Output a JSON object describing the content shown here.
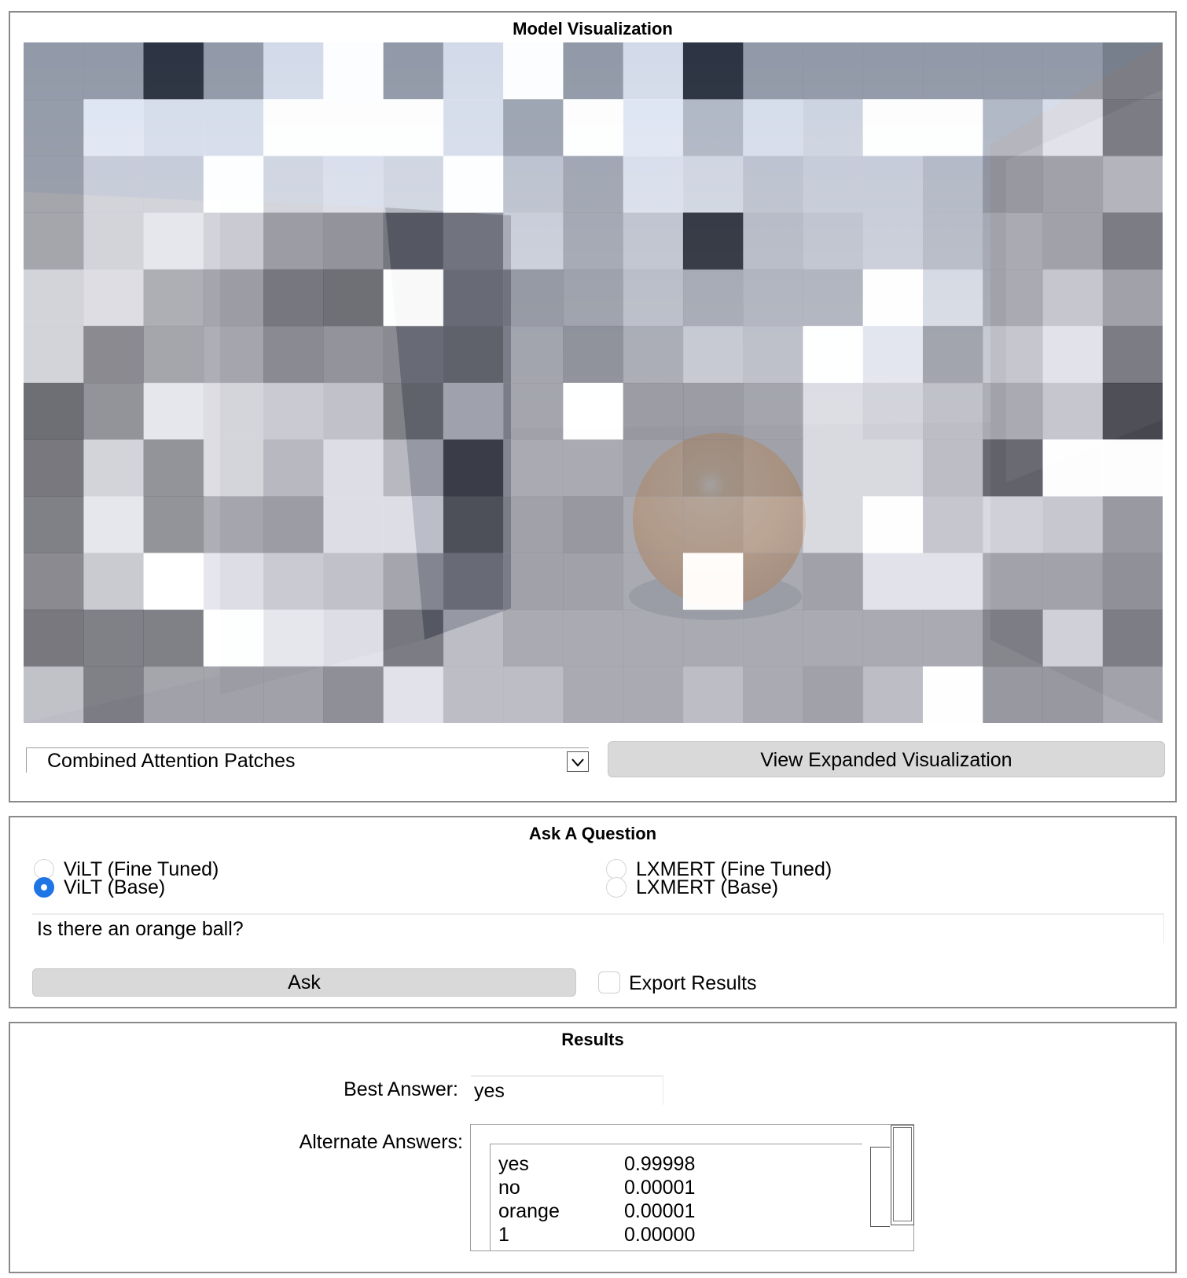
{
  "visualization": {
    "title": "Model Visualization",
    "mode_selected": "Combined Attention Patches",
    "expand_button": "View Expanded Visualization",
    "image": {
      "ball_color": "#f5a755",
      "sky_color": "#b8cfe6",
      "grid_cols": 19,
      "grid_rows": 12,
      "attention_mask": [
        [
          0.55,
          0.55,
          0.0,
          0.55,
          0.9,
          1.0,
          0.55,
          0.9,
          1.0,
          0.55,
          0.9,
          0.0,
          0.55,
          0.55,
          0.55,
          0.55,
          0.55,
          0.55,
          0.4
        ],
        [
          0.55,
          0.95,
          0.9,
          0.9,
          1.0,
          1.0,
          1.0,
          0.9,
          0.6,
          1.0,
          0.95,
          0.7,
          0.9,
          0.85,
          1.0,
          1.0,
          0.7,
          0.9,
          0.35
        ],
        [
          0.55,
          0.8,
          0.8,
          1.0,
          0.85,
          0.9,
          0.85,
          1.0,
          0.75,
          0.6,
          0.9,
          0.85,
          0.75,
          0.8,
          0.8,
          0.7,
          0.5,
          0.55,
          0.65
        ],
        [
          0.55,
          0.8,
          0.9,
          0.8,
          0.55,
          0.5,
          0.35,
          0.5,
          0.8,
          0.6,
          0.75,
          0.0,
          0.7,
          0.75,
          0.8,
          0.7,
          0.6,
          0.55,
          0.35
        ],
        [
          0.8,
          0.85,
          0.6,
          0.55,
          0.35,
          0.3,
          1.0,
          0.45,
          0.5,
          0.55,
          0.7,
          0.6,
          0.65,
          0.65,
          1.0,
          0.85,
          0.6,
          0.75,
          0.55
        ],
        [
          0.8,
          0.4,
          0.55,
          0.6,
          0.45,
          0.5,
          0.45,
          0.4,
          0.55,
          0.45,
          0.6,
          0.75,
          0.7,
          1.0,
          0.9,
          0.55,
          0.75,
          0.9,
          0.35
        ],
        [
          0.25,
          0.45,
          0.9,
          0.85,
          0.8,
          0.75,
          0.4,
          0.75,
          0.55,
          1.0,
          0.5,
          0.5,
          0.55,
          0.85,
          0.8,
          0.7,
          0.6,
          0.75,
          0.1
        ],
        [
          0.3,
          0.8,
          0.45,
          0.85,
          0.7,
          0.9,
          0.7,
          0.2,
          0.6,
          0.6,
          0.55,
          0.5,
          0.55,
          0.85,
          0.85,
          0.7,
          0.25,
          1.0,
          1.0
        ],
        [
          0.35,
          0.9,
          0.45,
          0.6,
          0.55,
          0.9,
          0.9,
          0.3,
          0.55,
          0.5,
          0.6,
          0.6,
          0.65,
          0.85,
          1.0,
          0.75,
          0.85,
          0.8,
          0.55
        ],
        [
          0.4,
          0.75,
          1.0,
          0.9,
          0.8,
          0.75,
          0.6,
          0.45,
          0.55,
          0.55,
          0.6,
          1.0,
          0.6,
          0.55,
          0.9,
          0.9,
          0.6,
          0.6,
          0.5
        ],
        [
          0.3,
          0.35,
          0.35,
          1.0,
          0.95,
          0.9,
          0.35,
          0.7,
          0.6,
          0.6,
          0.6,
          0.6,
          0.6,
          0.6,
          0.6,
          0.6,
          0.4,
          0.85,
          0.4
        ],
        [
          0.7,
          0.35,
          0.55,
          0.55,
          0.55,
          0.45,
          0.9,
          0.7,
          0.7,
          0.6,
          0.6,
          0.7,
          0.6,
          0.55,
          0.7,
          1.0,
          0.5,
          0.5,
          0.6
        ]
      ]
    }
  },
  "ask": {
    "title": "Ask A Question",
    "models": [
      {
        "label": "ViLT (Fine Tuned)",
        "checked": false
      },
      {
        "label": "ViLT (Base)",
        "checked": true
      },
      {
        "label": "LXMERT (Fine Tuned)",
        "checked": false
      },
      {
        "label": "LXMERT (Base)",
        "checked": false
      }
    ],
    "question": "Is there an orange ball?",
    "ask_button": "Ask",
    "export_label": "Export Results",
    "export_checked": false
  },
  "results": {
    "title": "Results",
    "best_label": "Best Answer:",
    "best_value": "yes",
    "alt_label": "Alternate Answers:",
    "alternates": [
      {
        "answer": "yes",
        "score": "0.99998"
      },
      {
        "answer": "no",
        "score": "0.00001"
      },
      {
        "answer": "orange",
        "score": "0.00001"
      },
      {
        "answer": "1",
        "score": "0.00000"
      }
    ]
  }
}
